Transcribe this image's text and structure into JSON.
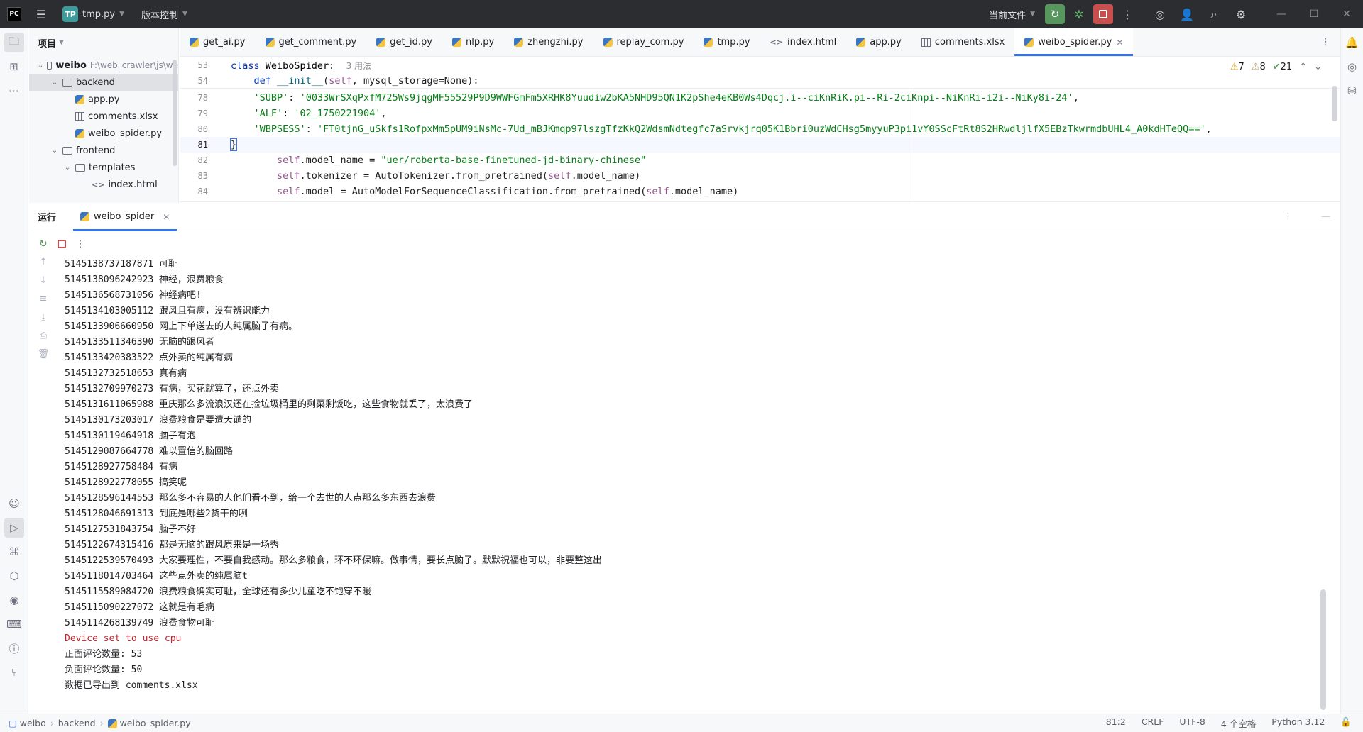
{
  "titlebar": {
    "ide_logo": "PC",
    "project_badge": "TP",
    "project_name": "tmp.py",
    "vcs_label": "版本控制",
    "run_config": "当前文件"
  },
  "project_panel": {
    "title": "项目",
    "tree": [
      {
        "label": "weibo",
        "path": "F:\\web_crawler\\js\\we"
      },
      {
        "label": "backend"
      },
      {
        "label": "app.py"
      },
      {
        "label": "comments.xlsx"
      },
      {
        "label": "weibo_spider.py"
      },
      {
        "label": "frontend"
      },
      {
        "label": "templates"
      },
      {
        "label": "index.html"
      }
    ]
  },
  "tabs": [
    {
      "label": "get_ai.py",
      "icon": "python-file-icon"
    },
    {
      "label": "get_comment.py",
      "icon": "python-file-icon"
    },
    {
      "label": "get_id.py",
      "icon": "python-file-icon"
    },
    {
      "label": "nlp.py",
      "icon": "python-file-icon"
    },
    {
      "label": "zhengzhi.py",
      "icon": "python-file-icon"
    },
    {
      "label": "replay_com.py",
      "icon": "python-file-icon"
    },
    {
      "label": "tmp.py",
      "icon": "python-file-icon"
    },
    {
      "label": "index.html",
      "icon": "html-file-icon"
    },
    {
      "label": "app.py",
      "icon": "python-file-icon"
    },
    {
      "label": "comments.xlsx",
      "icon": "table-file-icon"
    },
    {
      "label": "weibo_spider.py",
      "icon": "python-file-icon",
      "active": true
    }
  ],
  "editor": {
    "inspections": {
      "warn_a": "7",
      "warn_b": "8",
      "ok": "21"
    },
    "sticky": [
      {
        "ln": "53",
        "class_kw": "class",
        "class_name": " WeiboSpider:",
        "usage": "3 用法"
      },
      {
        "ln": "54",
        "def_kw": "def",
        "fn": "__init__",
        "args_a": "(",
        "self": "self",
        "args_b": ", mysql_storage=None):"
      }
    ],
    "lines": [
      {
        "ln": "78",
        "key": "'SUBP'",
        "colon": ": ",
        "val": "'0033WrSXqPxfM725Ws9jqgMF55529P9D9WWFGmFm5XRHK8Yuudiw2bKA5NHD95QN1K2pShe4eKB0Ws4Dqcj.i--ciKnRiK.pi--Ri-2ciKnpi--NiKnRi-i2i--NiKy8i-24'",
        "tail": ","
      },
      {
        "ln": "79",
        "key": "'ALF'",
        "colon": ": ",
        "val": "'02_1750221904'",
        "tail": ","
      },
      {
        "ln": "80",
        "key": "'WBPSESS'",
        "colon": ": ",
        "val": "'FT0tjnG_uSkfs1RofpxMm5pUM9iNsMc-7Ud_mBJKmqp97lszgTfzKkQ2WdsmNdtegfc7aSrvkjrq05K1Bbri0uzWdCHsg5myyuP3pi1vY0SScFtRt8S2HRwdljlfX5EBzTkwrmdbUHL4_A0kdHTeQQ=='",
        "tail": ","
      },
      {
        "ln": "81",
        "text": "}"
      },
      {
        "ln": "82",
        "self": "self",
        "a": ".model_name = ",
        "s": "\"uer/roberta-base-finetuned-jd-binary-chinese\""
      },
      {
        "ln": "83",
        "self": "self",
        "a": ".tokenizer = AutoTokenizer.from_pretrained(",
        "self2": "self",
        "b": ".model_name)"
      },
      {
        "ln": "84",
        "self": "self",
        "a": ".model = AutoModelForSequenceClassification.from_pretrained(",
        "self2": "self",
        "b": ".model_name)"
      }
    ]
  },
  "run_panel": {
    "title": "运行",
    "tab_label": "weibo_spider",
    "console": [
      "5145138737187871 可耻",
      "5145138096242923 神经，浪费粮食",
      "5145136568731056 神经病吧!",
      "5145134103005112 跟风且有病，没有辨识能力",
      "5145133906660950 网上下单送去的人纯属脑子有病。",
      "5145133511346390 无脑的跟风者",
      "5145133420383522 点外卖的纯属有病",
      "5145132732518653 真有病",
      "5145132709970273 有病，买花就算了，还点外卖",
      "5145131611065988 重庆那么多流浪汉还在捡垃圾桶里的剩菜剩饭吃，这些食物就丢了，太浪费了",
      "5145130173203017 浪费粮食是要遭天谴的",
      "5145130119464918 脑子有泡",
      "5145129087664778 难以置信的脑回路",
      "5145128927758484 有病",
      "5145128922778055 搞笑呢",
      "5145128596144553 那么多不容易的人他们看不到，给一个去世的人点那么多东西去浪费",
      "5145128046691313 到底是哪些2货干的咧",
      "5145127531843754 脑子不好",
      "5145122674315416 都是无脑的跟风原来是一场秀",
      "5145122539570493 大家要理性，不要自我感动。那么多粮食，环不环保嘛。做事情，要长点脑子。默默祝福也可以，非要整这出",
      "5145118014703464 这些点外卖的纯属脑t",
      "5145115589084720 浪费粮食确实可耻，全球还有多少儿童吃不饱穿不暖",
      "5145115090227072 这就是有毛病",
      "5145114268139749 浪费食物可耻"
    ],
    "console_tail": [
      {
        "text": "Device set to use cpu",
        "color": "#c7222d"
      },
      {
        "text": "正面评论数量: 53"
      },
      {
        "text": "负面评论数量: 50"
      },
      {
        "text": "数据已导出到 comments.xlsx"
      }
    ]
  },
  "statusbar": {
    "breadcrumb": [
      "weibo",
      "backend",
      "weibo_spider.py"
    ],
    "position": "81:2",
    "line_sep": "CRLF",
    "encoding": "UTF-8",
    "indent": "4 个空格",
    "interpreter": "Python 3.12"
  }
}
